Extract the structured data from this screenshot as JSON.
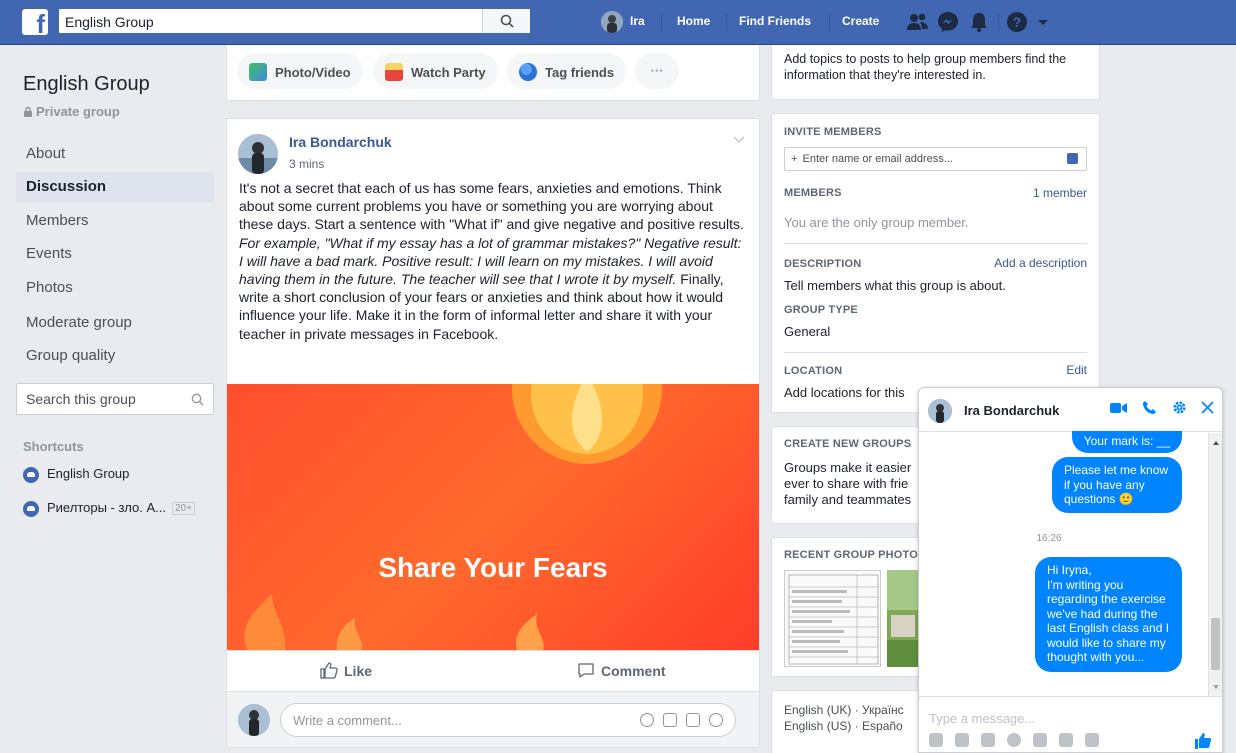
{
  "topbar": {
    "search_value": "English Group",
    "user_name": "Ira",
    "nav": [
      "Home",
      "Find Friends",
      "Create"
    ],
    "bg_color": "#4267b2"
  },
  "sidebar": {
    "group_name": "English Group",
    "privacy": "Private group",
    "menu": [
      "About",
      "Discussion",
      "Members",
      "Events",
      "Photos",
      "Moderate group",
      "Group quality"
    ],
    "active_item": "Discussion",
    "search_placeholder": "Search this group",
    "shortcuts_header": "Shortcuts",
    "shortcuts": [
      {
        "label": "English Group",
        "badge": ""
      },
      {
        "label": "Риелторы - зло. А...",
        "badge": "20+"
      }
    ]
  },
  "composer": {
    "actions": [
      "Photo/Video",
      "Watch Party",
      "Tag friends",
      "···"
    ]
  },
  "post": {
    "author": "Ira Bondarchuk",
    "time": "3 mins",
    "text_1": "It's not a secret that each of us has some fears, anxieties and emotions. Think about some current problems you have or something you are worrying about these days. Start a sentence with \"What if\" and give negative and positive results. ",
    "text_italic": "For example, \"What if my essay has a lot of grammar mistakes?\" Negative result: I will have a bad mark. Positive result: I will learn on my mistakes. I will avoid having them in the future. The teacher will see that I wrote it by myself.",
    "text_2": " Finally, write a short conclusion of your fears or anxieties and think about how it would influence your life. Make it in the form of informal letter and share it with your teacher in private messages in Facebook.",
    "image_title": "Share Your Fears",
    "like_label": "Like",
    "comment_label": "Comment",
    "comment_placeholder": "Write a comment..."
  },
  "right": {
    "topics_text": "Add topics to posts to help group members find the information that they're interested in.",
    "invite_label": "INVITE MEMBERS",
    "invite_placeholder": "Enter name or email address...",
    "members_label": "MEMBERS",
    "members_count": "1 member",
    "members_text": "You are the only group member.",
    "description_label": "DESCRIPTION",
    "description_link": "Add a description",
    "description_text": "Tell members what this group is about.",
    "group_type_label": "GROUP TYPE",
    "group_type_value": "General",
    "location_label": "LOCATION",
    "location_link": "Edit",
    "location_text": "Add locations for this",
    "create_label": "CREATE NEW GROUPS",
    "create_text_1": "Groups make it easier",
    "create_text_2": "ever to share with frie",
    "create_text_3": "family and teammates",
    "recent_label": "RECENT GROUP PHOTO",
    "lang_1": "English (UK) · Українс",
    "lang_2": "English (US) · Españo"
  },
  "chat": {
    "name": "Ira Bondarchuk",
    "messages": [
      "Your mark is: __",
      "Please let me know if you have any questions 🙂",
      "Hi Iryna,\nI'm writing you regarding the exercise we've had during the last English class and I would like to share my thought with you..."
    ],
    "time": "16:26",
    "input_placeholder": "Type a message...",
    "accent": "#0084ff"
  }
}
